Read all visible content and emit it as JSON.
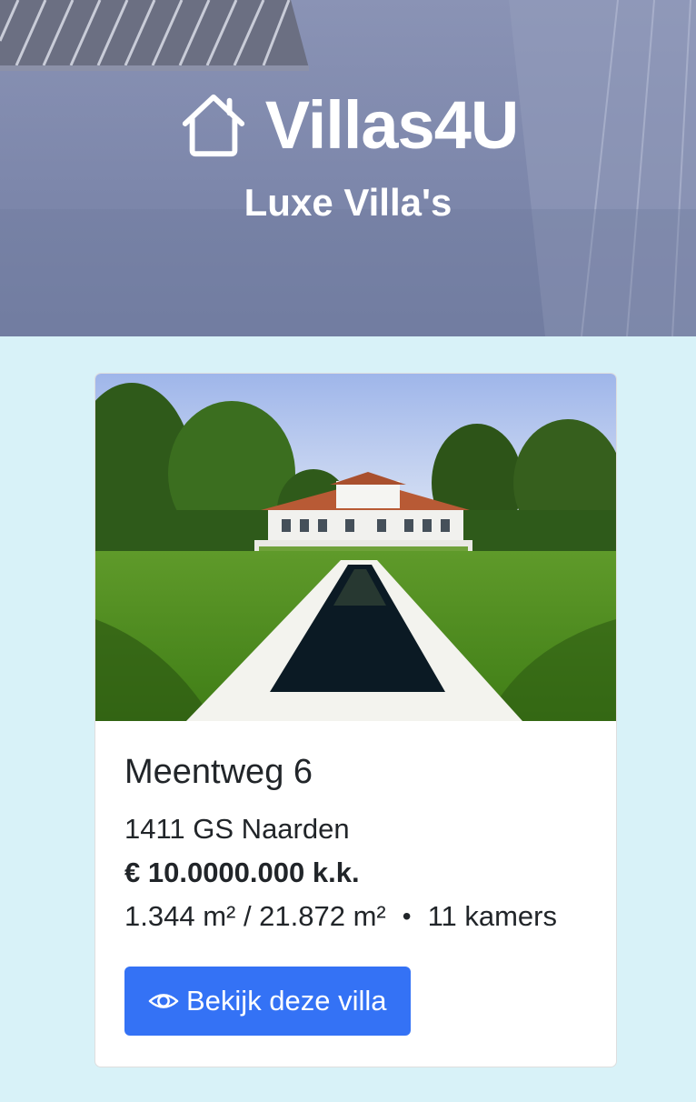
{
  "hero": {
    "brand": "Villas4U",
    "subtitle": "Luxe Villa's",
    "icon": "house-icon"
  },
  "listing": {
    "title": "Meentweg 6",
    "address": "1411 GS Naarden",
    "price": "€ 10.0000.000 k.k.",
    "area": "1.344 m² / 21.872 m²",
    "separator": "•",
    "rooms": "11 kamers",
    "button_label": "Bekijk deze villa",
    "button_icon": "eye-icon"
  },
  "colors": {
    "page_background": "#d8f2f8",
    "hero_overlay": "#7d87ab",
    "button": "#3472f5"
  }
}
